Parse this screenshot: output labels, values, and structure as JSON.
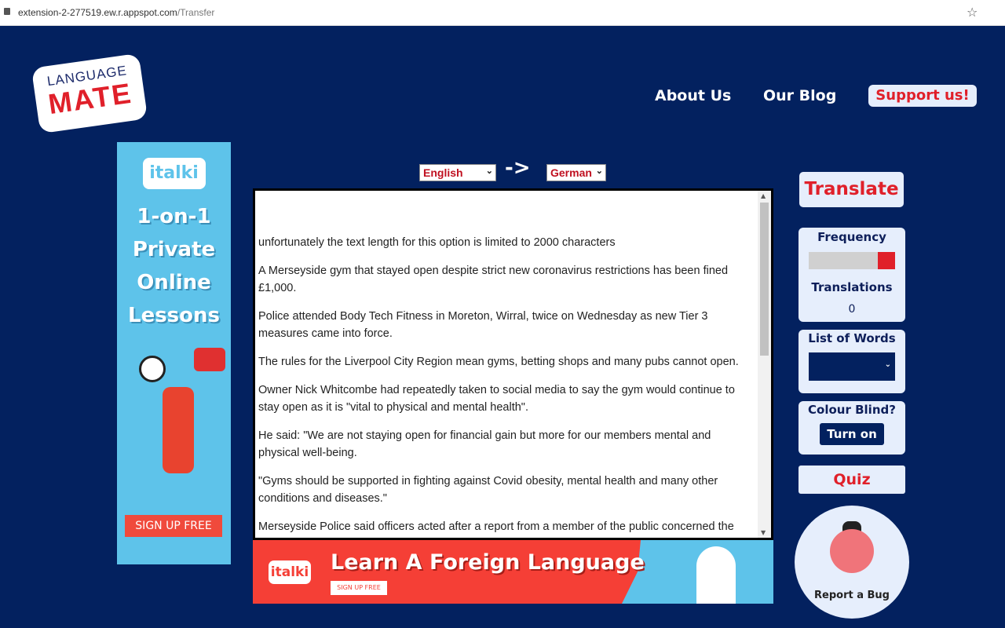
{
  "browser": {
    "url_host": "extension-2-277519.ew.r.appspot.com",
    "url_path": "/Transfer"
  },
  "logo": {
    "line1": "LANGUAGE",
    "line2": "MATE"
  },
  "nav": {
    "about": "About Us",
    "blog": "Our Blog",
    "support": "Support us!"
  },
  "side_ad": {
    "brand": "italki",
    "headline": [
      "1-on-1",
      "Private",
      "Online",
      "Lessons"
    ],
    "cta": "SIGN UP FREE"
  },
  "translator": {
    "source_lang": "English",
    "arrow": "->",
    "target_lang": "German",
    "paragraphs": [
      "unfortunately the text length for this option is limited to 2000 characters",
      "A Merseyside gym that stayed open despite strict new coronavirus restrictions has been fined £1,000.",
      "Police attended Body Tech Fitness in Moreton, Wirral, twice on Wednesday as new Tier 3 measures came into force.",
      "The rules for the Liverpool City Region mean gyms, betting shops and many pubs cannot open.",
      "Owner Nick Whitcombe had repeatedly taken to social media to say the gym would continue to stay open as it is \"vital to physical and mental health\".",
      "He said: \"We are not staying open for financial gain but more for our members mental and physical well-being.",
      "\"Gyms should be supported in fighting against Covid obesity, mental health and many other conditions and diseases.\"",
      "Merseyside Police said officers acted after a report from a member of the public concerned the"
    ]
  },
  "bottom_ad": {
    "brand": "italki",
    "headline": "Learn A Foreign Language",
    "cta": "SIGN UP FREE"
  },
  "controls": {
    "translate": "Translate",
    "frequency_label": "Frequency",
    "frequency_level": 0.2,
    "translations_label": "Translations",
    "translations_count": "0",
    "list_label": "List of Words",
    "colour_label": "Colour Blind?",
    "turn_on": "Turn on",
    "quiz": "Quiz",
    "report_bug": "Report a Bug"
  },
  "colors": {
    "background": "#03215f",
    "accent_red": "#e0202a",
    "panel": "#e6eefc",
    "ad_blue": "#5ec3ea",
    "ad_red": "#f53f36"
  }
}
